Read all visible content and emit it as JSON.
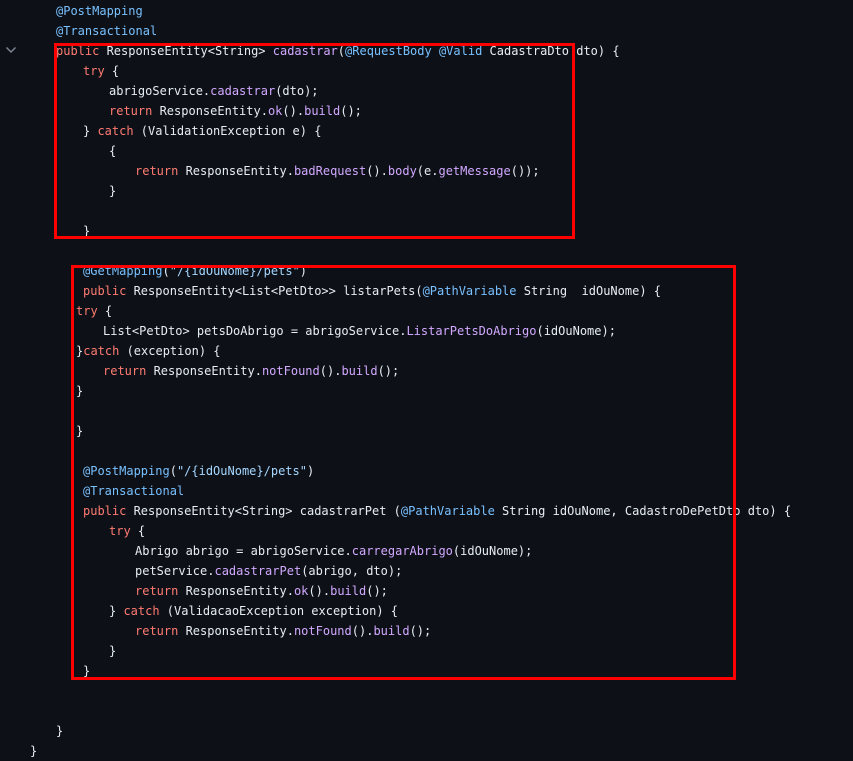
{
  "colors": {
    "background": "#0d1117",
    "text": "#e6edf3",
    "keyword": "#ff7b72",
    "annotation": "#79c0ff",
    "method": "#d2a8ff",
    "string": "#a5d6ff",
    "highlight_border": "#ff0000"
  },
  "icons": {
    "fold": "chevron-down-icon"
  },
  "code": {
    "lines": [
      {
        "indent": 0,
        "tokens": [
          [
            "annotation",
            "@PostMapping"
          ]
        ]
      },
      {
        "indent": 0,
        "tokens": [
          [
            "annotation",
            "@Transactional"
          ]
        ]
      },
      {
        "indent": 0,
        "tokens": [
          [
            "keyword",
            "public"
          ],
          [
            "text",
            " ResponseEntity<String> "
          ],
          [
            "method",
            "cadastrar"
          ],
          [
            "text",
            "("
          ],
          [
            "annotation",
            "@RequestBody"
          ],
          [
            "text",
            " "
          ],
          [
            "annotation",
            "@Valid"
          ],
          [
            "text",
            " CadastraDto dto) {"
          ]
        ]
      },
      {
        "indent": 1,
        "tokens": [
          [
            "keyword",
            "try"
          ],
          [
            "text",
            " {"
          ]
        ]
      },
      {
        "indent": 2,
        "tokens": [
          [
            "text",
            "abrigoService."
          ],
          [
            "method",
            "cadastrar"
          ],
          [
            "text",
            "(dto);"
          ]
        ]
      },
      {
        "indent": 2,
        "tokens": [
          [
            "keyword",
            "return"
          ],
          [
            "text",
            " ResponseEntity."
          ],
          [
            "method",
            "ok"
          ],
          [
            "text",
            "()."
          ],
          [
            "method",
            "build"
          ],
          [
            "text",
            "();"
          ]
        ]
      },
      {
        "indent": 1,
        "tokens": [
          [
            "text",
            "} "
          ],
          [
            "keyword",
            "catch"
          ],
          [
            "text",
            " (ValidationException e) {"
          ]
        ]
      },
      {
        "indent": 2,
        "tokens": [
          [
            "text",
            "{"
          ]
        ]
      },
      {
        "indent": 3,
        "tokens": [
          [
            "keyword",
            "return"
          ],
          [
            "text",
            " ResponseEntity."
          ],
          [
            "method",
            "badRequest"
          ],
          [
            "text",
            "()."
          ],
          [
            "method",
            "body"
          ],
          [
            "text",
            "(e."
          ],
          [
            "method",
            "getMessage"
          ],
          [
            "text",
            "());"
          ]
        ]
      },
      {
        "indent": 2,
        "tokens": [
          [
            "text",
            "}"
          ]
        ]
      },
      {
        "indent": 0,
        "tokens": []
      },
      {
        "indent": 1,
        "tokens": [
          [
            "text",
            "}"
          ]
        ]
      },
      {
        "indent": 0,
        "tokens": []
      },
      {
        "indent": 1,
        "tokens": [
          [
            "annotation",
            "@GetMapping"
          ],
          [
            "text",
            "("
          ],
          [
            "string",
            "\"/{idOuNome}/pets\""
          ],
          [
            "text",
            ")"
          ]
        ]
      },
      {
        "indent": 1,
        "tokens": [
          [
            "keyword",
            "public"
          ],
          [
            "text",
            " ResponseEntity<List<PetDto>> listarPets("
          ],
          [
            "annotation",
            "@PathVariable"
          ],
          [
            "text",
            " String  idOuNome) {"
          ]
        ]
      },
      {
        "indent": 0,
        "tokens": [
          [
            "keyword",
            "try"
          ],
          [
            "text",
            " {"
          ]
        ]
      },
      {
        "indent": 1,
        "tokens": [
          [
            "text",
            "List<PetDto> petsDoAbrigo = abrigoService."
          ],
          [
            "method",
            "ListarPetsDoAbrigo"
          ],
          [
            "text",
            "(idOuNome);"
          ]
        ]
      },
      {
        "indent": 0,
        "tokens": [
          [
            "text",
            "}"
          ],
          [
            "keyword",
            "catch"
          ],
          [
            "text",
            " (exception) {"
          ]
        ]
      },
      {
        "indent": 1,
        "tokens": [
          [
            "keyword",
            "return"
          ],
          [
            "text",
            " ResponseEntity."
          ],
          [
            "method",
            "notFound"
          ],
          [
            "text",
            "()."
          ],
          [
            "method",
            "build"
          ],
          [
            "text",
            "();"
          ]
        ]
      },
      {
        "indent": 0,
        "tokens": [
          [
            "text",
            "}"
          ]
        ]
      },
      {
        "indent": 0,
        "tokens": []
      },
      {
        "indent": 0,
        "tokens": [
          [
            "text",
            "}"
          ]
        ]
      },
      {
        "indent": 0,
        "tokens": []
      },
      {
        "indent": 1,
        "tokens": [
          [
            "annotation",
            "@PostMapping"
          ],
          [
            "text",
            "("
          ],
          [
            "string",
            "\"/{idOuNome}/pets\""
          ],
          [
            "text",
            ")"
          ]
        ]
      },
      {
        "indent": 1,
        "tokens": [
          [
            "annotation",
            "@Transactional"
          ]
        ]
      },
      {
        "indent": 1,
        "tokens": [
          [
            "keyword",
            "public"
          ],
          [
            "text",
            " ResponseEntity<String> cadastrarPet ("
          ],
          [
            "annotation",
            "@PathVariable"
          ],
          [
            "text",
            " String idOuNome, CadastroDePetDto dto) {"
          ]
        ]
      },
      {
        "indent": 2,
        "tokens": [
          [
            "keyword",
            "try"
          ],
          [
            "text",
            " {"
          ]
        ]
      },
      {
        "indent": 3,
        "tokens": [
          [
            "text",
            "Abrigo abrigo = abrigoService."
          ],
          [
            "method",
            "carregarAbrigo"
          ],
          [
            "text",
            "(idOuNome);"
          ]
        ]
      },
      {
        "indent": 3,
        "tokens": [
          [
            "text",
            "petService."
          ],
          [
            "method",
            "cadastrarPet"
          ],
          [
            "text",
            "(abrigo, dto);"
          ]
        ]
      },
      {
        "indent": 3,
        "tokens": [
          [
            "keyword",
            "return"
          ],
          [
            "text",
            " ResponseEntity."
          ],
          [
            "method",
            "ok"
          ],
          [
            "text",
            "()."
          ],
          [
            "method",
            "build"
          ],
          [
            "text",
            "();"
          ]
        ]
      },
      {
        "indent": 2,
        "tokens": [
          [
            "text",
            "} "
          ],
          [
            "keyword",
            "catch"
          ],
          [
            "text",
            " (ValidacaoException exception) {"
          ]
        ]
      },
      {
        "indent": 3,
        "tokens": [
          [
            "keyword",
            "return"
          ],
          [
            "text",
            " ResponseEntity."
          ],
          [
            "method",
            "notFound"
          ],
          [
            "text",
            "()."
          ],
          [
            "method",
            "build"
          ],
          [
            "text",
            "();"
          ]
        ]
      },
      {
        "indent": 2,
        "tokens": [
          [
            "text",
            "}"
          ]
        ]
      },
      {
        "indent": 1,
        "tokens": [
          [
            "text",
            "}"
          ]
        ]
      },
      {
        "indent": 0,
        "tokens": []
      },
      {
        "indent": 0,
        "tokens": []
      },
      {
        "indent": 0,
        "tokens": [
          [
            "text",
            "}"
          ]
        ]
      },
      {
        "indent": -1,
        "tokens": [
          [
            "text",
            "}"
          ]
        ]
      }
    ]
  }
}
